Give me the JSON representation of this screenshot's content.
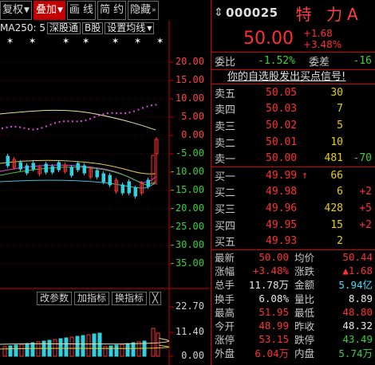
{
  "toolbar": {
    "fq_label": "复权",
    "overlay_label": "叠加",
    "draw_label": "画 线",
    "brief_label": "简 约",
    "hide_label": "隐藏"
  },
  "indicator_row": {
    "ma_label": "MA250: 5",
    "market_label": "深股通",
    "b_label": "B股",
    "setting_label": "设置均线"
  },
  "price_axis": [
    "20.00",
    "15.00",
    "10.00",
    "5.00",
    "0.00",
    "-5.00",
    "-10.00",
    "-15.00",
    "-20.00",
    "-25.00",
    "-30.00",
    "-35.00"
  ],
  "volume_axis": [
    "22.70",
    "11.40",
    "0.00"
  ],
  "volume_tools": {
    "params_label": "改参数",
    "add_label": "加指标",
    "switch_label": "换指标",
    "close_label": "╳"
  },
  "quote": {
    "code": "000025",
    "name": "特 力A",
    "price": "50.00",
    "change": "+1.68",
    "change_pct": "+3.48%",
    "weibi_label": "委比",
    "weibi_value": "-1.52%",
    "weicha_label": "委差",
    "weicha_value": "-16",
    "notice": "你的自选股发出买点信号!"
  },
  "order_book": {
    "asks": [
      {
        "label": "卖五",
        "price": "50.05",
        "vol": "30",
        "chg": ""
      },
      {
        "label": "卖四",
        "price": "50.03",
        "vol": "7",
        "chg": ""
      },
      {
        "label": "卖三",
        "price": "50.02",
        "vol": "5",
        "chg": ""
      },
      {
        "label": "卖二",
        "price": "50.01",
        "vol": "10",
        "chg": ""
      },
      {
        "label": "卖一",
        "price": "50.00",
        "vol": "481",
        "chg": "-70"
      }
    ],
    "bids": [
      {
        "label": "买一",
        "price": "49.99",
        "vol": "66",
        "chg": ""
      },
      {
        "label": "买二",
        "price": "49.98",
        "vol": "6",
        "chg": "+2"
      },
      {
        "label": "买三",
        "price": "49.96",
        "vol": "428",
        "chg": "+5"
      },
      {
        "label": "买四",
        "price": "49.95",
        "vol": "15",
        "chg": "+2"
      },
      {
        "label": "买五",
        "price": "49.93",
        "vol": "2",
        "chg": ""
      }
    ],
    "bid1_arrow": "↑"
  },
  "stats": [
    {
      "l1": "最新",
      "v1": "50.00",
      "c1": "red",
      "l2": "均价",
      "v2": "50.44",
      "c2": "red"
    },
    {
      "l1": "涨幅",
      "v1": "+3.48%",
      "c1": "red",
      "l2": "涨跌",
      "v2": "▲1.68",
      "c2": "red"
    },
    {
      "l1": "总手",
      "v1": "11.78万",
      "c1": "wht",
      "l2": "金额",
      "v2": "5.94亿",
      "c2": "cyn"
    },
    {
      "l1": "换手",
      "v1": "6.08%",
      "c1": "wht",
      "l2": "量比",
      "v2": "8.89",
      "c2": "wht"
    },
    {
      "l1": "最高",
      "v1": "51.95",
      "c1": "red",
      "l2": "最低",
      "v2": "48.80",
      "c2": "red"
    },
    {
      "l1": "今开",
      "v1": "48.99",
      "c1": "red",
      "l2": "昨收",
      "v2": "48.32",
      "c2": "wht"
    },
    {
      "l1": "涨停",
      "v1": "53.15",
      "c1": "red",
      "l2": "跌停",
      "v2": "43.49",
      "c2": "grn"
    },
    {
      "l1": "外盘",
      "v1": "6.04万",
      "c1": "red",
      "l2": "内盘",
      "v2": "5.74万",
      "c2": "grn"
    }
  ],
  "colors": {
    "up": "#ff3030",
    "down": "#3cd03c",
    "border": "#c80000",
    "accent": "#40e0ff"
  }
}
